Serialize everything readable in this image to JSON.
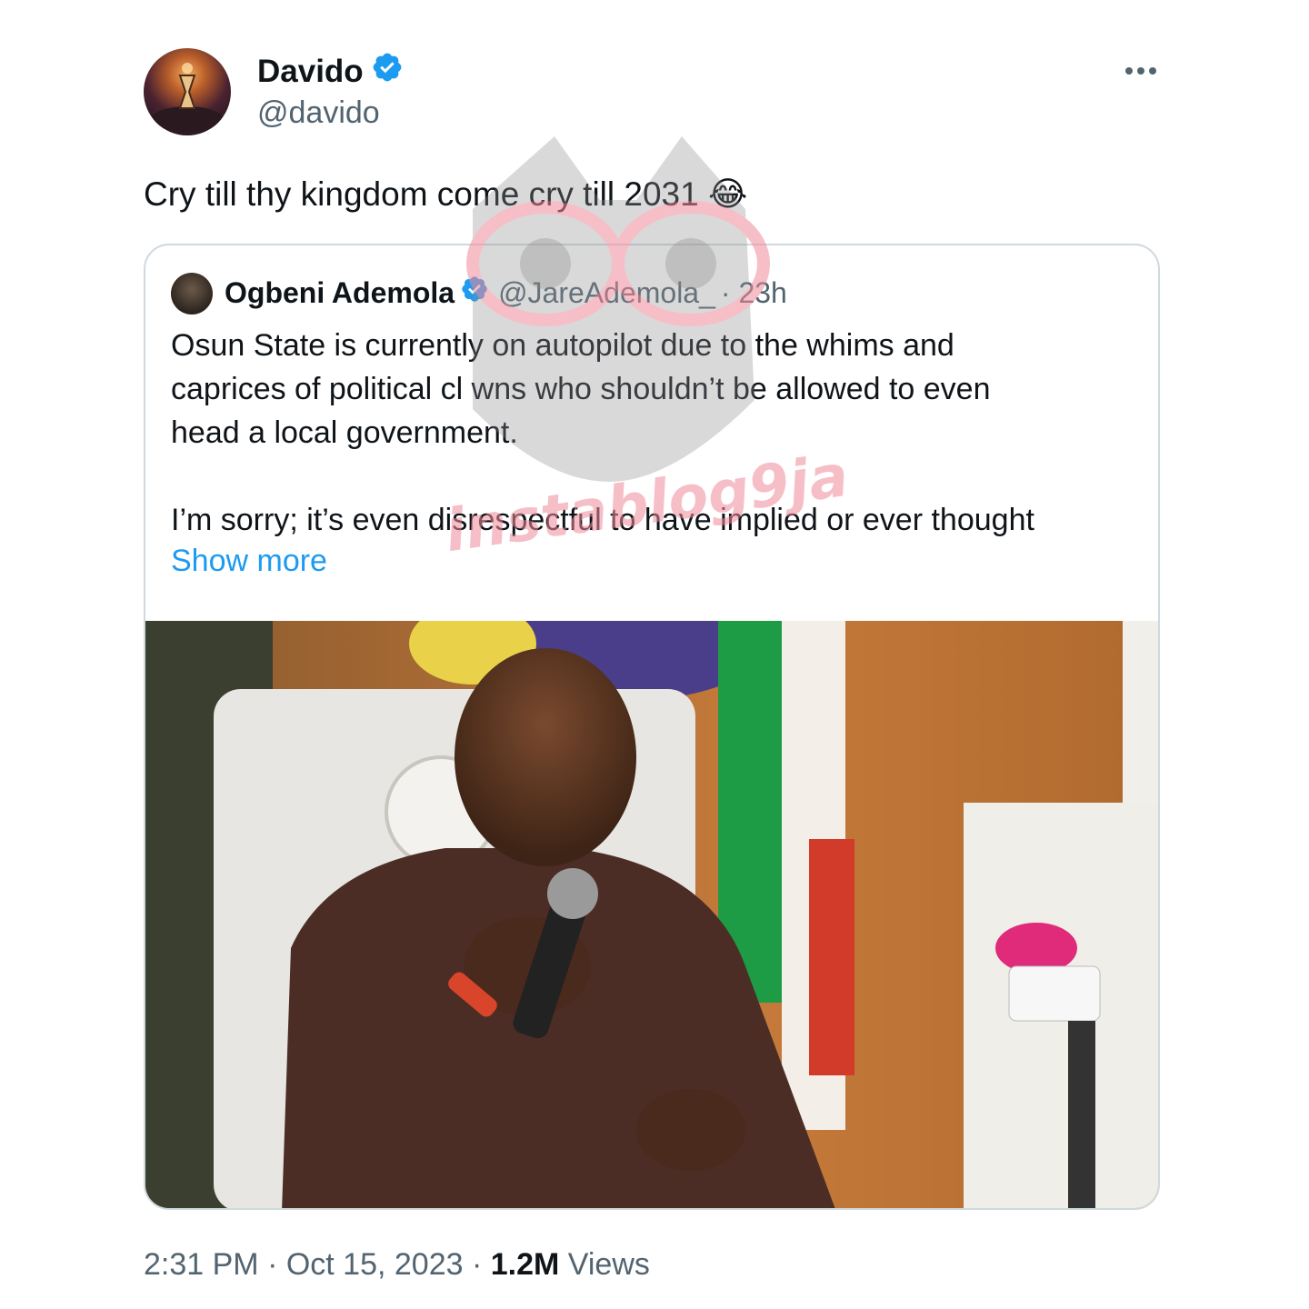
{
  "tweet": {
    "author": {
      "name": "Davido",
      "handle": "@davido",
      "verified": true
    },
    "text": "Cry till thy kingdom come cry till 2031",
    "emoji": "😂",
    "more_icon": "more-horizontal-icon",
    "timestamp": "2:31 PM · Oct 15, 2023",
    "separator": " · ",
    "views_count": "1.2M",
    "views_label": " Views"
  },
  "quote": {
    "author": {
      "name": "Ogbeni Ademola",
      "handle": "@JareAdemola_",
      "verified": true
    },
    "time": " · 23h",
    "body_line_1": "Osun State is currently on autopilot due to the whims and",
    "body_line_2": "caprices of political cl wns who shouldn’t be allowed to even",
    "body_line_3": "head a local government.",
    "body_line_4": "I’m sorry; it’s even disrespectful to have implied or ever thought",
    "show_more": "Show more"
  },
  "watermark": {
    "text": "instablog9ja"
  },
  "colors": {
    "verified": "#1d9bf0",
    "link": "#1d9bf0",
    "secondary_text": "#536471",
    "border": "#cfd9de"
  }
}
